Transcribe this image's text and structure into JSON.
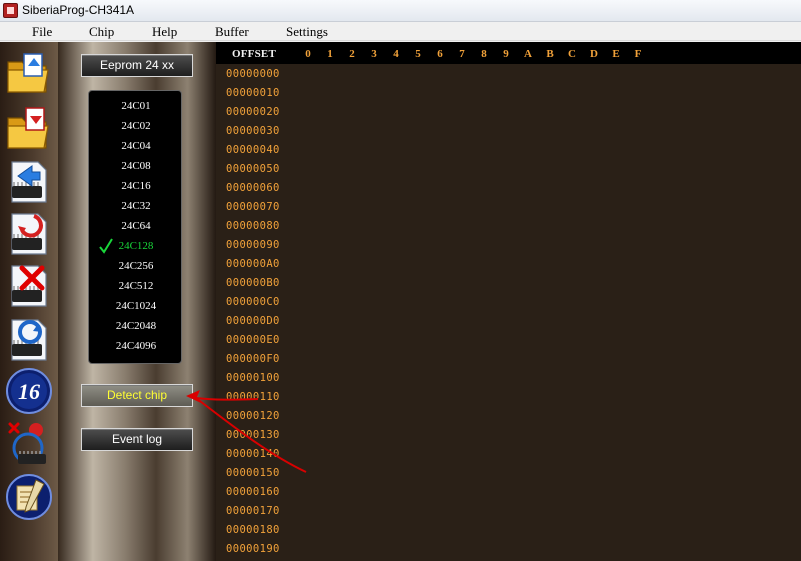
{
  "window": {
    "title": "SiberiaProg-CH341A"
  },
  "menu": [
    "File",
    "Chip",
    "Help",
    "Buffer",
    "Settings"
  ],
  "toolbar": {
    "icons": [
      "open-folder-icon",
      "save-folder-icon",
      "read-chip-icon",
      "write-chip-icon",
      "erase-chip-icon",
      "verify-chip-icon",
      "hex-16-icon",
      "auto-program-icon",
      "edit-scroll-icon"
    ],
    "hex16_label": "16"
  },
  "chip_panel": {
    "family_button": "Eeprom 24 xx",
    "chips": [
      "24C01",
      "24C02",
      "24C04",
      "24C08",
      "24C16",
      "24C32",
      "24C64",
      "24C128",
      "24C256",
      "24C512",
      "24C1024",
      "24C2048",
      "24C4096"
    ],
    "selected_index": 7,
    "detect_button": "Detect chip",
    "event_log_button": "Event log"
  },
  "hex": {
    "offset_label": "OFFSET",
    "columns": [
      "0",
      "1",
      "2",
      "3",
      "4",
      "5",
      "6",
      "7",
      "8",
      "9",
      "A",
      "B",
      "C",
      "D",
      "E",
      "F"
    ],
    "rows": [
      "00000000",
      "00000010",
      "00000020",
      "00000030",
      "00000040",
      "00000050",
      "00000060",
      "00000070",
      "00000080",
      "00000090",
      "000000A0",
      "000000B0",
      "000000C0",
      "000000D0",
      "000000E0",
      "000000F0",
      "00000100",
      "00000110",
      "00000120",
      "00000130",
      "00000140",
      "00000150",
      "00000160",
      "00000170",
      "00000180",
      "00000190"
    ]
  },
  "colors": {
    "accent_orange": "#f2a23a",
    "selected_green": "#19d63a",
    "detect_text": "#ffff33",
    "annotation_red": "#d90000"
  }
}
